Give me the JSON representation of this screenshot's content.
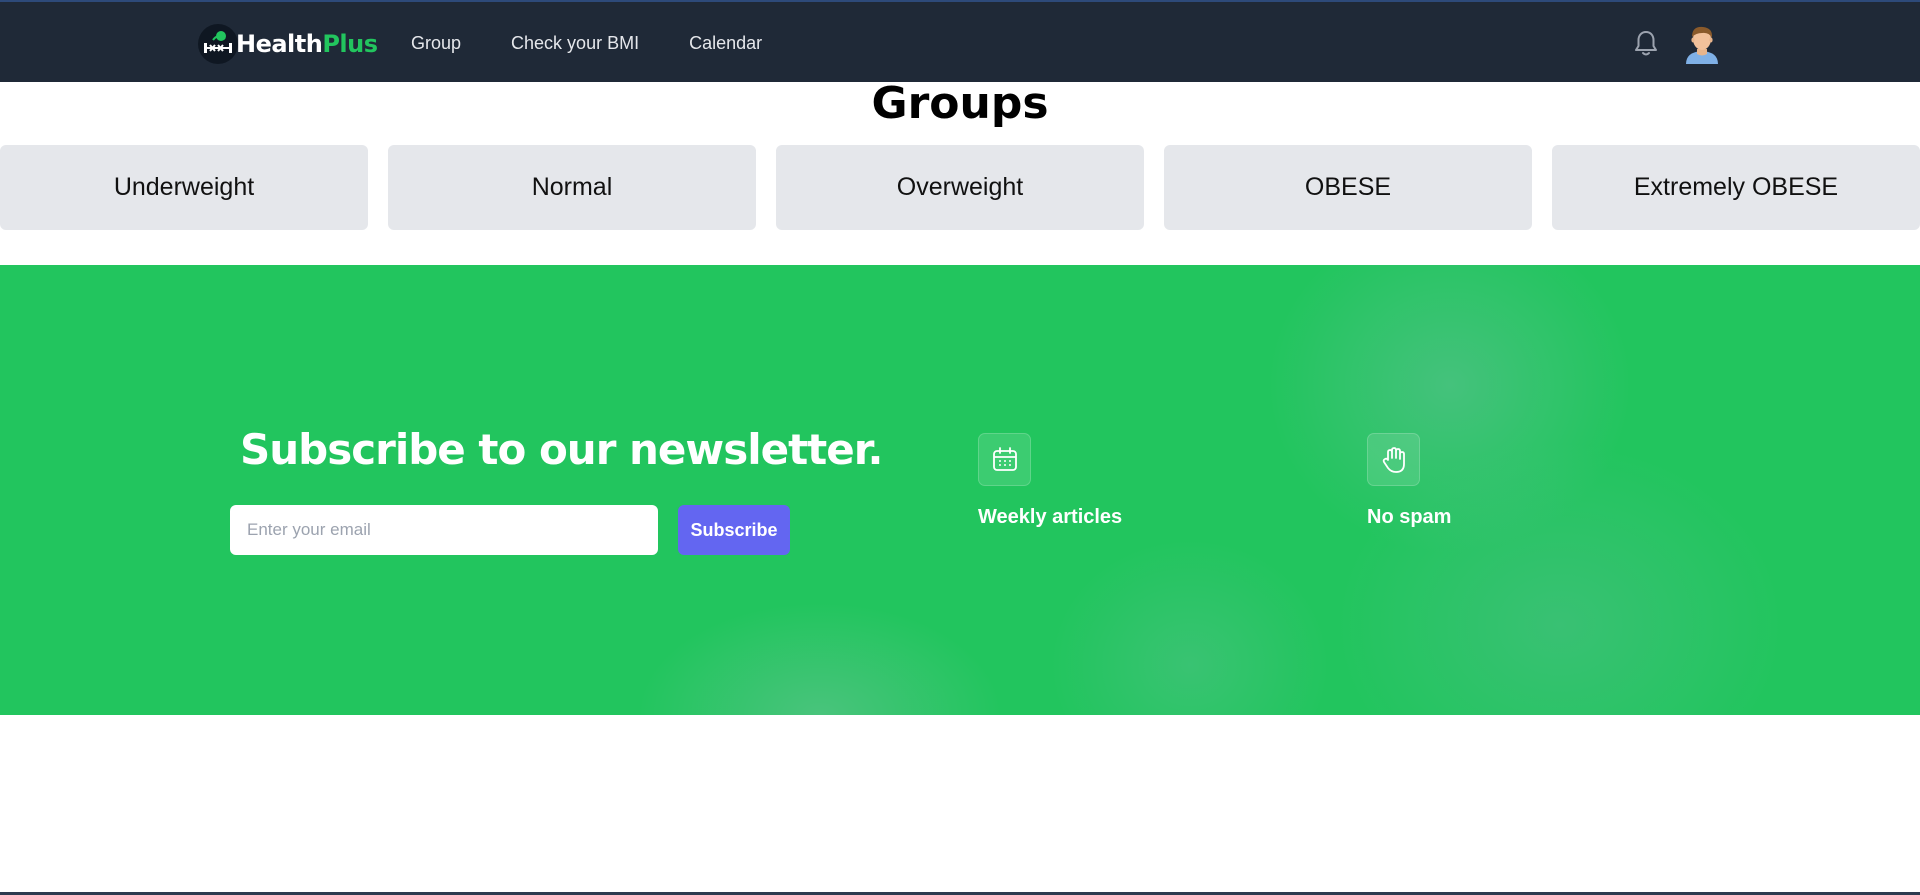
{
  "navbar": {
    "logo": {
      "text_main": "Health",
      "text_accent": "Plus",
      "icon": "dumbbell-logo-icon"
    },
    "links": [
      {
        "label": "Group"
      },
      {
        "label": "Check your BMI"
      },
      {
        "label": "Calendar"
      }
    ],
    "notification_icon": "bell-icon",
    "avatar_icon": "user-avatar-icon"
  },
  "groups": {
    "title": "Groups",
    "items": [
      {
        "label": "Underweight"
      },
      {
        "label": "Normal"
      },
      {
        "label": "Overweight"
      },
      {
        "label": "OBESE"
      },
      {
        "label": "Extremely OBESE"
      }
    ]
  },
  "newsletter": {
    "title": "Subscribe to our newsletter.",
    "email_placeholder": "Enter your email",
    "email_value": "",
    "subscribe_label": "Subscribe",
    "features": [
      {
        "label": "Weekly articles",
        "icon": "calendar-icon"
      },
      {
        "label": "No spam",
        "icon": "hand-stop-icon"
      }
    ]
  },
  "colors": {
    "navbar_bg": "#1f2937",
    "brand_green": "#22c55e",
    "button_indigo": "#6366f1",
    "card_bg": "#e5e7eb"
  }
}
